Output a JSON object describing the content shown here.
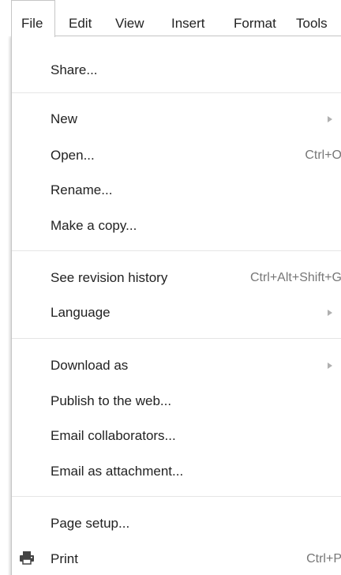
{
  "menubar": {
    "items": [
      "File",
      "Edit",
      "View",
      "Insert",
      "Format",
      "Tools"
    ]
  },
  "file_menu": {
    "share": "Share...",
    "new": "New",
    "open": "Open...",
    "open_shortcut": "Ctrl+O",
    "rename": "Rename...",
    "make_copy": "Make a copy...",
    "revision_history": "See revision history",
    "revision_history_shortcut": "Ctrl+Alt+Shift+G",
    "language": "Language",
    "download_as": "Download as",
    "publish": "Publish to the web...",
    "email_collaborators": "Email collaborators...",
    "email_attachment": "Email as attachment...",
    "page_setup": "Page setup...",
    "print": "Print",
    "print_shortcut": "Ctrl+P"
  },
  "icons": {
    "print": "printer-icon",
    "submenu": "submenu-arrow-icon"
  },
  "colors": {
    "text": "#222222",
    "shortcut_text": "#777777",
    "border": "#c6c6c6",
    "separator": "#e5e5e5",
    "arrow": "#b0b0b0",
    "icon": "#444444"
  }
}
